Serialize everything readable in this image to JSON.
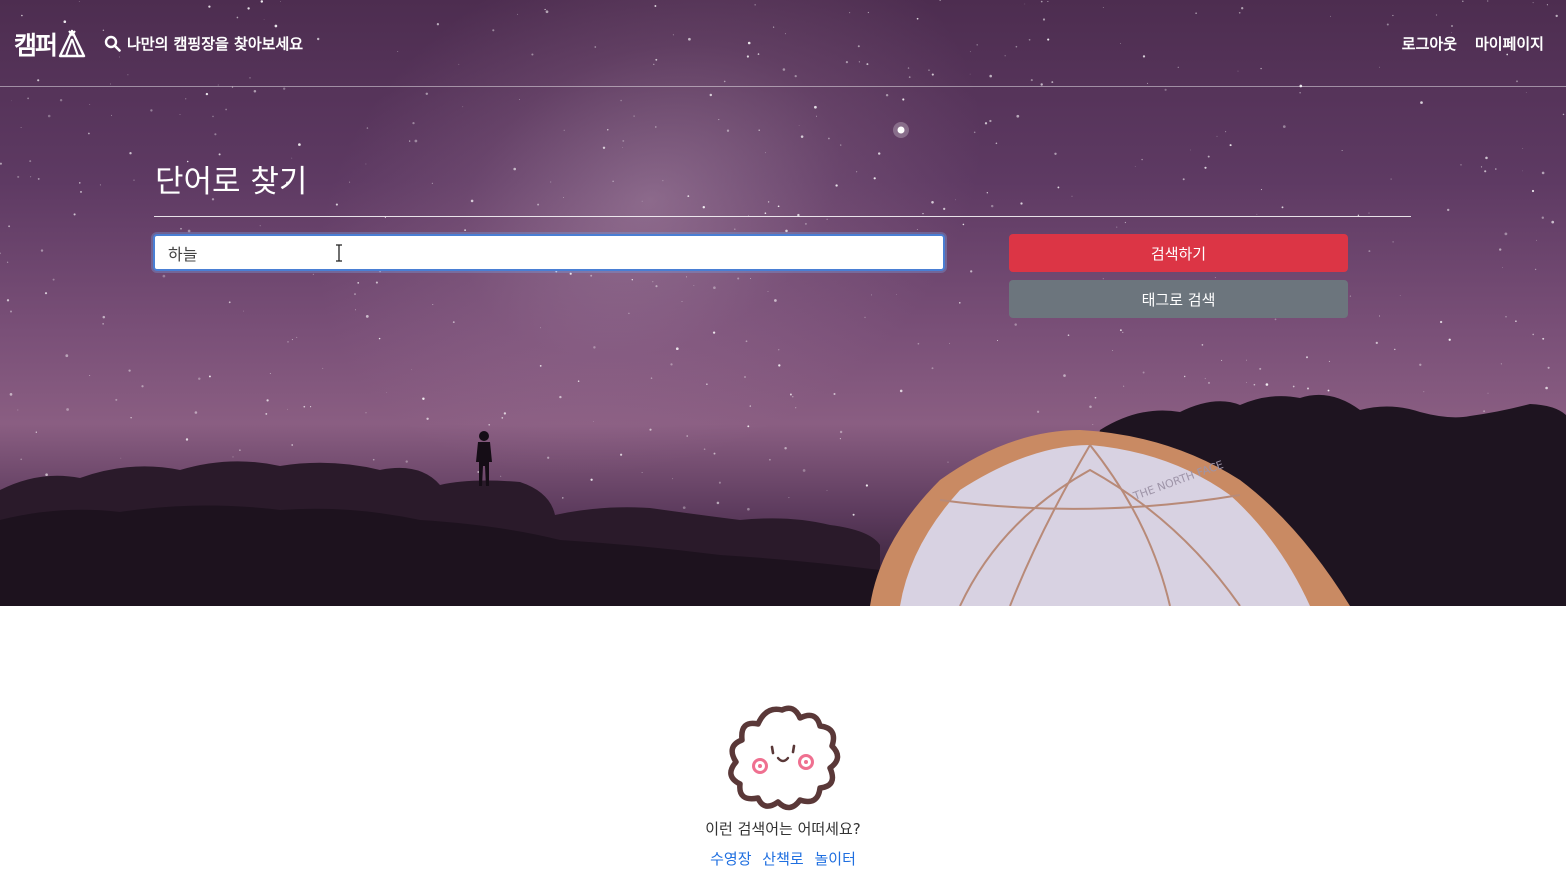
{
  "navbar": {
    "brand": "캠퍼",
    "search_prompt": "나만의 캠핑장을 찾아보세요",
    "logout": "로그아웃",
    "mypage": "마이페이지"
  },
  "search": {
    "title": "단어로 찾기",
    "query": "하늘",
    "search_button": "검색하기",
    "tag_button": "태그로 검색"
  },
  "suggestions": {
    "question": "이런 검색어는 어떠세요?",
    "keywords": [
      "수영장",
      "산책로",
      "놀이터"
    ]
  },
  "colors": {
    "search_button": "#dc3545",
    "tag_button": "#6c757d",
    "link": "#1f6fe0"
  }
}
